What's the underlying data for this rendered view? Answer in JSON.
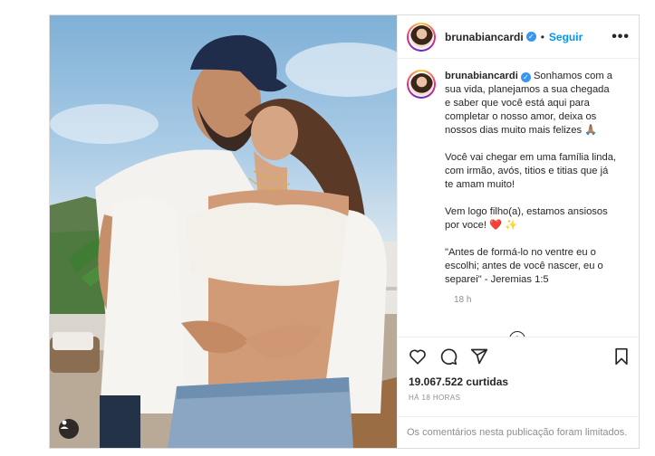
{
  "post": {
    "username": "brunabiancardi",
    "verified_mark": "✓",
    "follow_label": "Seguir",
    "more_label": "•••",
    "caption": {
      "username": "brunabiancardi",
      "paragraphs": [
        "Sonhamos com a sua vida, planejamos a sua chegada e saber que você está aqui para completar o nosso amor, deixa os nossos dias muito mais felizes 🙏🏽",
        "Você vai chegar em uma família linda, com irmão, avós, titios e titias que já te amam muito!",
        "Vem logo filho(a), estamos ansiosos por voce! ❤️ ✨",
        "\"Antes de formá-lo no ventre eu o escolhi; antes de você nascer, eu o separei\" - Jeremias 1:5"
      ],
      "time_ago": "18 h"
    },
    "add_comment_icon": "plus-circle-icon",
    "actions": {
      "icons": [
        "heart-icon",
        "comment-icon",
        "share-icon",
        "bookmark-icon"
      ]
    },
    "likes_count": "19.067.522",
    "likes_label": "curtidas",
    "timestamp": "HÁ 18 HORAS",
    "comments_limited": "Os comentários nesta publicação foram limitados.",
    "photo_tag_icon": "user-tag-icon"
  },
  "colors": {
    "accent_blue": "#0095f6",
    "verified_blue": "#3897f0",
    "muted": "#8e8e8e",
    "border": "#dbdbdb"
  }
}
